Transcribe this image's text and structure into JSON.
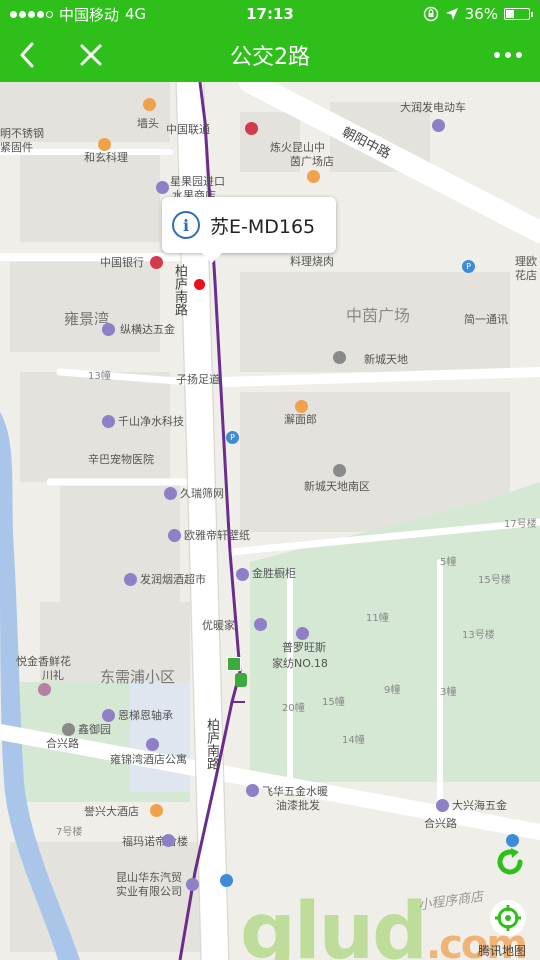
{
  "status_bar": {
    "carrier": "中国移动",
    "network": "4G",
    "time": "17:13",
    "battery": "36%",
    "battery_level": 0.36
  },
  "nav": {
    "title": "公交2路"
  },
  "popup": {
    "info_glyph": "i",
    "plate": "苏E-MD165"
  },
  "map": {
    "labels": {
      "qiangtou": "墙头",
      "zhongguo_liantong": "中国联通",
      "daruanfa": "大润发电动车",
      "mingbuxiu": "明不锈钢",
      "jingu": "紧固件",
      "hexuan": "和玄科理",
      "zhaoyang_road": "朝阳中路",
      "kunshan_plaza_1": "炼火昆山中",
      "kunshan_plaza_2": "茵广场店",
      "xingguoyuan": "星果园进口",
      "shuiguo": "水果商店",
      "bank_of_china": "中国银行",
      "bailu_road_1": "柏庐南路",
      "liaoli": "料理烧肉",
      "licai": "理欧",
      "huadian": "花店",
      "yongjingwan": "雍景湾",
      "zhongyin_plaza": "中茵广场",
      "jianyi": "简一通讯",
      "zongheng": "纵横达五金",
      "xinchengtiandi": "新城天地",
      "num13": "13幢",
      "zishou": "子扬足道",
      "qianshan": "千山净水科技",
      "xielang": "澥面郎",
      "xinba": "辛巴宠物医院",
      "xincheng_south": "新城天地南区",
      "jiurui": "久瑞筛网",
      "num17": "17号楼",
      "ouya": "欧雅帝轩壁纸",
      "num5": "5幢",
      "num15": "15号楼",
      "farun": "发润烟酒超市",
      "jinshi": "金胜橱柜",
      "num11": "11幢",
      "youjia": "优暖家",
      "num13b": "13号楼",
      "yuejin": "悦金香鲜花",
      "chuanli": "川礼",
      "puluowang": "普罗旺斯",
      "jiafang": "家纺NO.18",
      "dongxupu": "东需浦小区",
      "num9": "9幢",
      "num3": "3幢",
      "num20": "20幢",
      "num15b": "15幢",
      "num14": "14幢",
      "enti": "恩梯恩轴承",
      "xinyuyuan": "鑫御园",
      "bailu_road_2": "柏庐南路",
      "hexing_road_1": "合兴路",
      "yongjin_hotel": "雍锦湾酒店公寓",
      "feihua": "飞华五金水暖",
      "youqi": "油漆批发",
      "daxinghai": "大兴海五金",
      "hexing_road_2": "合兴路",
      "yuxing_hotel": "誉兴大酒店",
      "num7": "7号楼",
      "fuma": "福玛诺帝舍楼",
      "huadong_1": "昆山华东汽贸",
      "huadong_2": "实业有限公司",
      "map_brand": "腾讯地图"
    }
  },
  "watermark": {
    "brand": "glud",
    "suffix": ".com",
    "script": "小程序商店"
  },
  "colors": {
    "brand_green": "#2fbf1a",
    "route_purple": "#6b2d8b",
    "bus_red": "#e8101b",
    "info_blue": "#2d6fb7"
  },
  "icons": {
    "back": "chevron-left-icon",
    "close": "close-icon",
    "more": "more-dots-icon",
    "info": "info-icon",
    "refresh": "refresh-icon",
    "locate": "locate-icon"
  }
}
